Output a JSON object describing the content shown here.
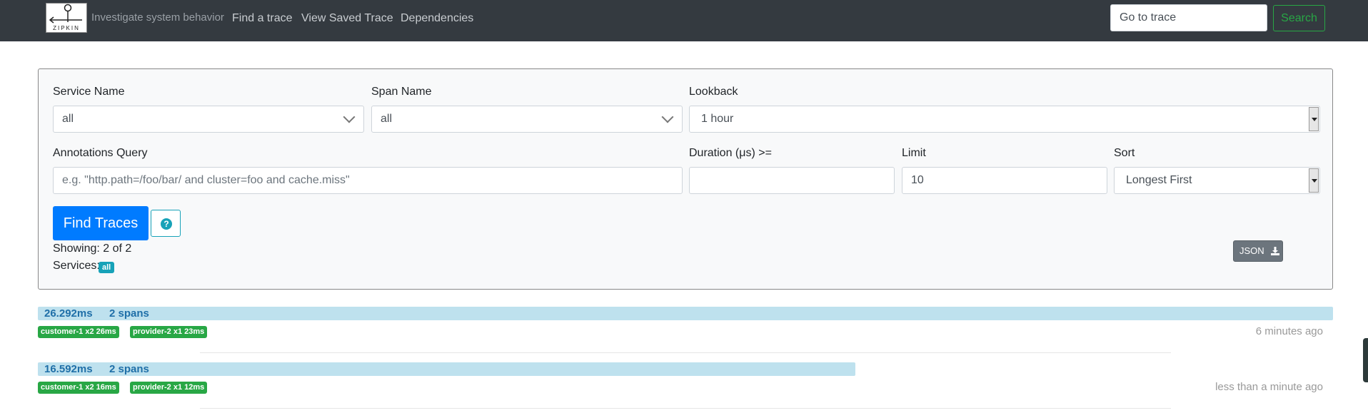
{
  "navbar": {
    "logo_text": "ZIPKIN",
    "tagline": "Investigate system behavior",
    "links": [
      "Find a trace",
      "View Saved Trace",
      "Dependencies"
    ],
    "goto_placeholder": "Go to trace",
    "search_label": "Search"
  },
  "form": {
    "service_name": {
      "label": "Service Name",
      "value": "all"
    },
    "span_name": {
      "label": "Span Name",
      "value": "all"
    },
    "lookback": {
      "label": "Lookback",
      "value": "1 hour"
    },
    "annotations": {
      "label": "Annotations Query",
      "placeholder": "e.g. \"http.path=/foo/bar/ and cluster=foo and cache.miss\""
    },
    "duration": {
      "label": "Duration (μs) >=",
      "value": ""
    },
    "limit": {
      "label": "Limit",
      "value": "10"
    },
    "sort": {
      "label": "Sort",
      "value": "Longest First"
    },
    "find_button": "Find Traces",
    "help_icon": "question-circle-icon",
    "showing": "Showing: 2 of 2",
    "services_label": "Services:",
    "services_badge": "all",
    "json_button": "JSON",
    "json_icon": "download-icon"
  },
  "traces": [
    {
      "duration": "26.292ms",
      "spans": "2 spans",
      "duration_fraction": 1.0,
      "services": [
        "customer-1 x2 26ms",
        "provider-2 x1 23ms"
      ],
      "ago": "6 minutes ago"
    },
    {
      "duration": "16.592ms",
      "spans": "2 spans",
      "duration_fraction": 0.631,
      "services": [
        "customer-1 x2 16ms",
        "provider-2 x1 12ms"
      ],
      "ago": "less than a minute ago"
    }
  ],
  "colors": {
    "navbar": "#343a40",
    "primary": "#007bff",
    "success": "#28a745",
    "info": "#17a2b8",
    "trace_bar": "#bee1ee"
  }
}
